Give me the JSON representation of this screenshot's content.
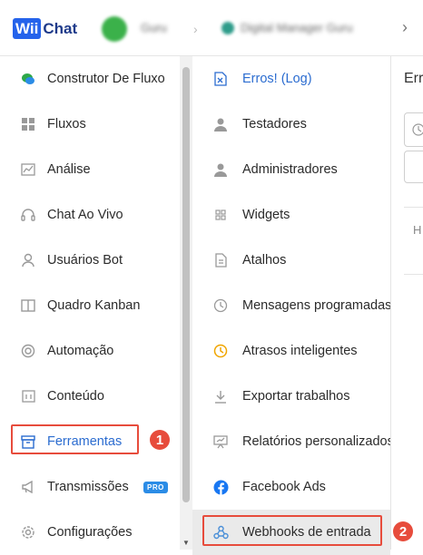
{
  "header": {
    "logo_part1": "Wii",
    "logo_part2": "Chat",
    "user_name": "Guru",
    "account_name": "Digital Manager Guru",
    "separator": "›",
    "chevron": "›"
  },
  "sidebar": {
    "items": [
      {
        "label": "Construtor De Fluxo",
        "icon": "chat-bubbles-icon"
      },
      {
        "label": "Fluxos",
        "icon": "grid-icon"
      },
      {
        "label": "Análise",
        "icon": "chart-icon"
      },
      {
        "label": "Chat Ao Vivo",
        "icon": "headset-icon"
      },
      {
        "label": "Usuários Bot",
        "icon": "user-icon"
      },
      {
        "label": "Quadro Kanban",
        "icon": "book-icon"
      },
      {
        "label": "Automação",
        "icon": "lifebuoy-icon"
      },
      {
        "label": "Conteúdo",
        "icon": "calendar-icon"
      },
      {
        "label": "Ferramentas",
        "icon": "archive-icon"
      },
      {
        "label": "Transmissões",
        "icon": "megaphone-icon",
        "badge": "PRO"
      },
      {
        "label": "Configurações",
        "icon": "gear-icon"
      }
    ],
    "annotation": "1"
  },
  "submenu": {
    "items": [
      {
        "label": "Erros! (Log)",
        "icon": "excel-icon"
      },
      {
        "label": "Testadores",
        "icon": "person-icon"
      },
      {
        "label": "Administradores",
        "icon": "person-icon"
      },
      {
        "label": "Widgets",
        "icon": "widget-icon"
      },
      {
        "label": "Atalhos",
        "icon": "document-icon"
      },
      {
        "label": "Mensagens programadas",
        "icon": "clock-icon"
      },
      {
        "label": "Atrasos inteligentes",
        "icon": "clock-icon"
      },
      {
        "label": "Exportar trabalhos",
        "icon": "download-icon"
      },
      {
        "label": "Relatórios personalizados",
        "icon": "presentation-icon"
      },
      {
        "label": "Facebook Ads",
        "icon": "facebook-icon"
      },
      {
        "label": "Webhooks de entrada",
        "icon": "webhook-icon"
      }
    ],
    "annotation": "2"
  },
  "main": {
    "title": "Err",
    "col": "H"
  },
  "colors": {
    "accent": "#2b6cd0",
    "highlight": "#e74c3c",
    "logo": "#2563eb"
  }
}
